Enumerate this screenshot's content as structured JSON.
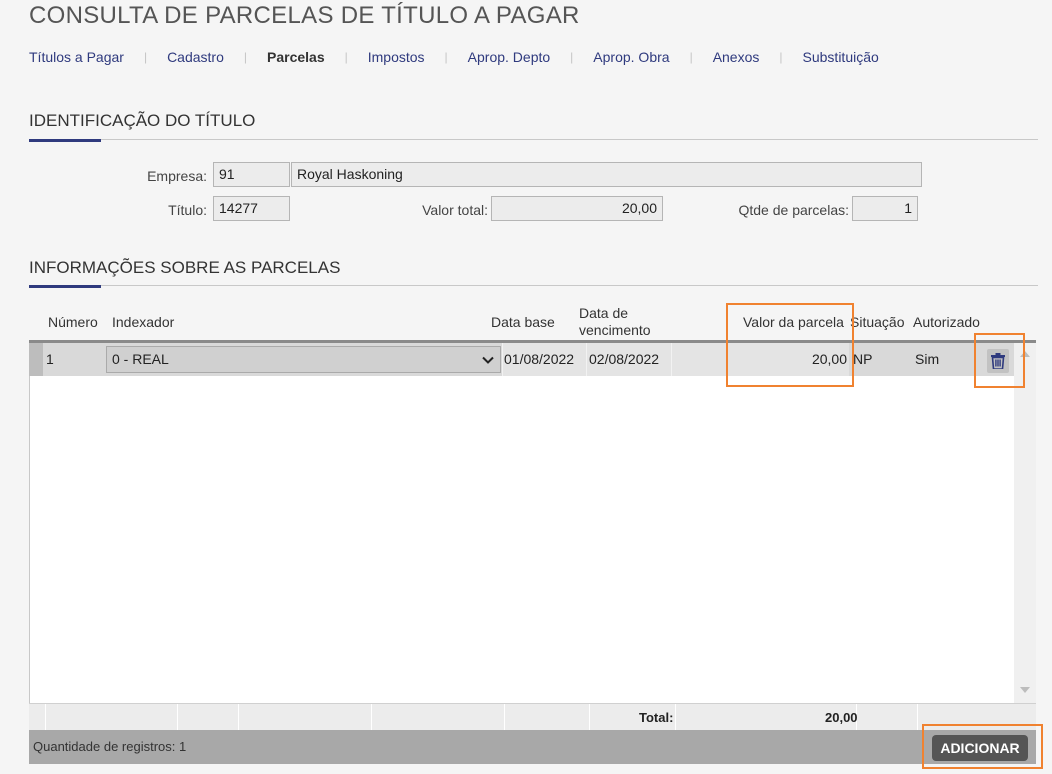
{
  "page": {
    "title": "CONSULTA DE PARCELAS DE TÍTULO A PAGAR"
  },
  "tabs": [
    {
      "label": "Títulos a Pagar"
    },
    {
      "label": "Cadastro"
    },
    {
      "label": "Parcelas"
    },
    {
      "label": "Impostos"
    },
    {
      "label": "Aprop. Depto"
    },
    {
      "label": "Aprop. Obra"
    },
    {
      "label": "Anexos"
    },
    {
      "label": "Substituição"
    }
  ],
  "identificacao": {
    "section_title": "IDENTIFICAÇÃO DO TÍTULO",
    "empresa_label": "Empresa:",
    "empresa_code": "91",
    "empresa_name": "Royal Haskoning",
    "titulo_label": "Título:",
    "titulo_value": "14277",
    "valor_total_label": "Valor total:",
    "valor_total_value": "20,00",
    "qtde_label": "Qtde de parcelas:",
    "qtde_value": "1"
  },
  "parcelas": {
    "section_title": "INFORMAÇÕES SOBRE AS PARCELAS",
    "columns": {
      "numero": "Número",
      "indexador": "Indexador",
      "data_base": "Data base",
      "data_venc": "Data de vencimento",
      "valor": "Valor da parcela",
      "situacao": "Situação",
      "autorizado": "Autorizado"
    },
    "rows": [
      {
        "numero": "1",
        "indexador": "0 - REAL",
        "data_base": "01/08/2022",
        "data_venc": "02/08/2022",
        "valor": "20,00",
        "situacao": "NP",
        "autorizado": "Sim"
      }
    ],
    "total_label": "Total:",
    "total_value": "20,00",
    "record_count": "Quantidade de registros: 1",
    "add_label": "ADICIONAR"
  },
  "icons": {
    "delete": "trash-icon",
    "dropdown": "chevron-down-icon"
  },
  "colors": {
    "accent": "#2f3a7e",
    "highlight": "#f08230",
    "button": "#555555"
  }
}
